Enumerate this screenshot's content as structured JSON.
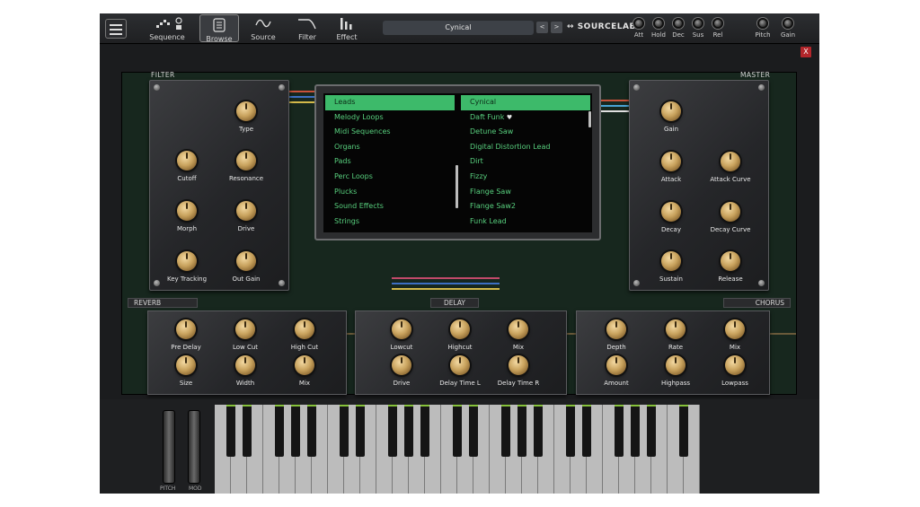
{
  "toolbar": {
    "sequence": "Sequence",
    "browse": "Browse",
    "source": "Source",
    "filter": "Filter",
    "effect": "Effect",
    "preset_name": "Cynical",
    "prev": "<",
    "next": ">",
    "brand": "SOURCELAB",
    "mini_knobs": [
      "Att",
      "Hold",
      "Dec",
      "Sus",
      "Rel",
      "Pitch",
      "Gain"
    ]
  },
  "sections": {
    "filter": "FILTER",
    "master": "MASTER",
    "reverb": "REVERB",
    "delay": "DELAY",
    "chorus": "CHORUS"
  },
  "close_label": "X",
  "filter_knobs": [
    "Type",
    "Cutoff",
    "Resonance",
    "Morph",
    "Drive",
    "Key Tracking",
    "Out Gain"
  ],
  "master_knobs": [
    "Gain",
    "Attack",
    "Attack Curve",
    "Decay",
    "Decay Curve",
    "Sustain",
    "Release"
  ],
  "reverb_knobs": [
    "Pre Delay",
    "Low Cut",
    "High Cut",
    "Size",
    "Width",
    "Mix"
  ],
  "delay_knobs": [
    "Lowcut",
    "Highcut",
    "Mix",
    "Drive",
    "Delay Time L",
    "Delay Time R"
  ],
  "chorus_knobs": [
    "Depth",
    "Rate",
    "Mix",
    "Amount",
    "Highpass",
    "Lowpass"
  ],
  "browser": {
    "categories": [
      "Leads",
      "Melody Loops",
      "Midi Sequences",
      "Organs",
      "Pads",
      "Perc Loops",
      "Plucks",
      "Sound Effects",
      "Strings"
    ],
    "selected_category": "Leads",
    "presets": [
      "Cynical",
      "Daft Funk",
      "Detune Saw",
      "Digital Distortion Lead",
      "Dirt",
      "Fizzy",
      "Flange Saw",
      "Flange Saw2",
      "Funk Lead"
    ],
    "selected_preset": "Cynical",
    "favorite_marker": "♥"
  },
  "wheels": {
    "pitch": "PITCH",
    "mod": "MOD"
  },
  "colors": {
    "accent_green": "#3dba6a",
    "list_text": "#58d07e",
    "knob_gold": "#c9a35e",
    "close_red": "#b3262b"
  }
}
